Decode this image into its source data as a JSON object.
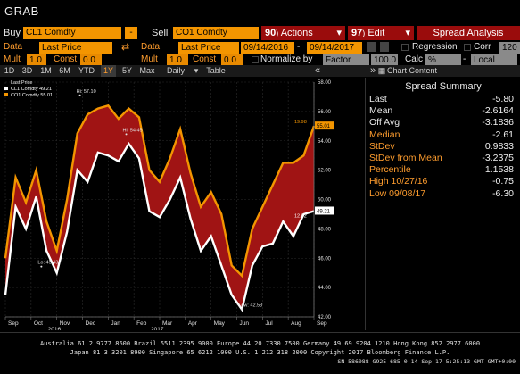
{
  "app": {
    "title": "GRAB"
  },
  "toolbar": {
    "buy_label": "Buy",
    "buy_ticker": "CL1 Comdty",
    "minus_label": "-",
    "sell_label": "Sell",
    "sell_ticker": "CO1 Comdty",
    "actions_num": "90",
    "actions_label": "Actions",
    "edit_num": "97",
    "edit_label": "Edit",
    "spread_analysis_label": "Spread Analysis",
    "data_label": "Data",
    "data_value": "Last Price",
    "data2_label": "Data",
    "data2_value": "Last Price",
    "date_from": "09/14/2016",
    "date_sep": "-",
    "date_to": "09/14/2017",
    "regression_label": "Regression",
    "corr_label": "Corr",
    "corr_value": "120",
    "mult_label": "Mult",
    "mult_value": "1.0",
    "const_label": "Const",
    "const_value": "0.0",
    "mult2_label": "Mult",
    "mult2_value": "1.0",
    "const2_label": "Const",
    "const2_value": "0.0",
    "normalize_label": "Normalize by",
    "factor_value": "Factor",
    "factor_num": "100.0",
    "calc_label": "Calc",
    "calc_value": "%",
    "local_value": "Local",
    "currency_sep": "-",
    "periods": [
      "1D",
      "3D",
      "1M",
      "6M",
      "YTD",
      "1Y",
      "5Y",
      "Max"
    ],
    "selected_period": "1Y",
    "freq_value": "Daily",
    "table_label": "Table",
    "collapse_left": "«",
    "collapse_right": "»",
    "chart_content_label": "Chart Content"
  },
  "summary": {
    "title": "Spread Summary",
    "rows": [
      {
        "label": "Last",
        "value": "-5.80",
        "style": "w"
      },
      {
        "label": "Mean",
        "value": "-2.6164",
        "style": "w"
      },
      {
        "label": "Off Avg",
        "value": "-3.1836",
        "style": "w"
      },
      {
        "label": "Median",
        "value": "-2.61",
        "style": "o"
      },
      {
        "label": "StDev",
        "value": "0.9833",
        "style": "o"
      },
      {
        "label": "StDev from Mean",
        "value": "-3.2375",
        "style": "o"
      },
      {
        "label": "Percentile",
        "value": "1.1538",
        "style": "o"
      },
      {
        "label": "High 10/27/16",
        "value": "-0.75",
        "style": "o"
      },
      {
        "label": "Low 09/08/17",
        "value": "-6.30",
        "style": "o"
      }
    ]
  },
  "colors": {
    "brand_orange": "#f39500",
    "cl1_line": "#ffffff",
    "co1_line": "#f39500",
    "spread_fill": "#a01414",
    "red_button": "#9a0c0c"
  },
  "chart_data": {
    "type": "line",
    "legend_title": "Last Price",
    "legend_placement": "top-left",
    "ylim": [
      42,
      58
    ],
    "yticks": [
      42,
      44,
      46,
      48,
      50,
      52,
      54,
      56,
      58
    ],
    "ytick_labels": [
      "42.00",
      "44.00",
      "46.00",
      "48.00",
      "50.00",
      "52.00",
      "54.00",
      "56.00",
      "58.00"
    ],
    "xtick_labels": [
      "Sep",
      "Oct",
      "Nov",
      "Dec",
      "Jan",
      "Feb",
      "Mar",
      "Apr",
      "May",
      "Jun",
      "Jul",
      "Aug",
      "Sep"
    ],
    "year_labels": [
      {
        "label": "2016",
        "after": "Nov"
      },
      {
        "label": "2017",
        "after": "Mar"
      }
    ],
    "x": [
      0,
      0.4,
      0.8,
      1.2,
      1.6,
      2.0,
      2.4,
      2.8,
      3.2,
      3.6,
      4.0,
      4.4,
      4.8,
      5.2,
      5.6,
      6.0,
      6.4,
      6.8,
      7.2,
      7.6,
      8.0,
      8.4,
      8.8,
      9.2,
      9.6,
      10.0,
      10.4,
      10.8,
      11.2,
      11.6,
      12.0
    ],
    "series": [
      {
        "name": "CL1 Comdty",
        "last_label": "49.21",
        "color": "#ffffff",
        "values": [
          43.5,
          49.5,
          48.0,
          50.2,
          46.5,
          45.0,
          47.8,
          52.0,
          51.2,
          53.2,
          53.0,
          52.6,
          53.8,
          52.8,
          49.2,
          48.8,
          50.0,
          51.5,
          48.7,
          46.5,
          47.5,
          45.5,
          43.5,
          42.5,
          45.5,
          46.8,
          47.0,
          48.5,
          47.5,
          49.0,
          49.21
        ]
      },
      {
        "name": "CO1 Comdty",
        "last_label": "55.01",
        "color": "#f39500",
        "values": [
          46.0,
          51.5,
          49.8,
          52.0,
          48.5,
          46.5,
          50.0,
          54.5,
          55.8,
          56.2,
          56.4,
          55.5,
          56.2,
          55.6,
          52.0,
          51.2,
          52.8,
          54.8,
          51.8,
          49.5,
          50.5,
          49.0,
          45.5,
          44.8,
          48.0,
          49.5,
          51.0,
          52.5,
          52.5,
          53.0,
          55.01
        ]
      }
    ],
    "annotations": [
      {
        "label": "Hi: 57.10",
        "x": 2.9,
        "y": 57.1,
        "series": "CO1 Comdty"
      },
      {
        "label": "Hi: 54.45",
        "x": 4.7,
        "y": 54.45,
        "series": "CL1 Comdty"
      },
      {
        "label": "Lo: 45.43",
        "x": 1.4,
        "y": 45.43,
        "series": "CO1 Comdty"
      },
      {
        "label": "Low: 42.53",
        "x": 9.2,
        "y": 42.53,
        "series": "CL1 Comdty"
      },
      {
        "label": "19.98",
        "x": 12.0,
        "y": 55.01,
        "series": "CO1 Comdty"
      },
      {
        "label": "12.92",
        "x": 12.0,
        "y": 49.21,
        "series": "CL1 Comdty"
      }
    ]
  },
  "footer": {
    "line1": "Australia 61 2 9777 8600 Brazil 5511 2395 9000 Europe 44 20 7330 7500 Germany 49 69 9204 1210 Hong Kong 852 2977 6000",
    "line2": "Japan 81 3 3201 8900        Singapore 65 6212 1000        U.S. 1 212 318 2000        Copyright 2017 Bloomberg Finance L.P.",
    "line3": "SN 586088 G925-685-0 14-Sep-17  5:25:13 GMT  GMT+0:00"
  }
}
